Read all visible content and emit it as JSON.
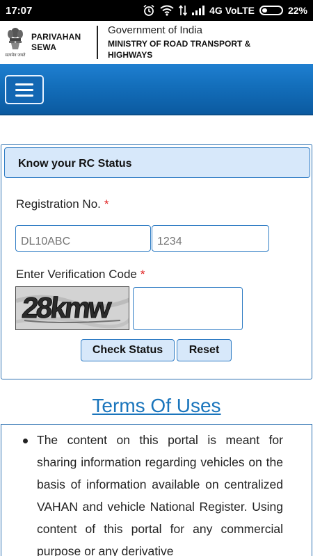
{
  "status_bar": {
    "time": "17:07",
    "network": "4G VoLTE",
    "battery": "22%",
    "battery_level": 0.22,
    "icons": [
      "alarm-icon",
      "wifi-icon",
      "data-arrows-icon",
      "signal-icon",
      "battery-icon"
    ]
  },
  "header": {
    "brand_line1": "PARIVAHAN",
    "brand_line2": "SEWA",
    "emblem_motto": "सत्यमेव जयते",
    "gov_line": "Government of India",
    "ministry_line1": "MINISTRY OF ROAD TRANSPORT &",
    "ministry_line2": "HIGHWAYS"
  },
  "rc_form": {
    "title": "Know your RC Status",
    "registration_label": "Registration No.",
    "required_mark": "*",
    "reg_part1_placeholder": "DL10ABC",
    "reg_part2_placeholder": "1234",
    "verification_label": "Enter Verification Code",
    "captcha_text": "28kmw",
    "captcha_value": "",
    "check_button": "Check Status",
    "reset_button": "Reset"
  },
  "terms": {
    "title": "Terms Of Uses",
    "item1": "The content on this portal is meant for sharing information regarding vehicles on the basis of information available on centralized VAHAN and vehicle National Register. Using content of this portal for any commercial purpose or any derivative"
  },
  "colors": {
    "nav_blue": "#1470bd",
    "accent": "#1a75bc",
    "panel_bg": "#d7e8fa",
    "required_red": "#e02020"
  }
}
